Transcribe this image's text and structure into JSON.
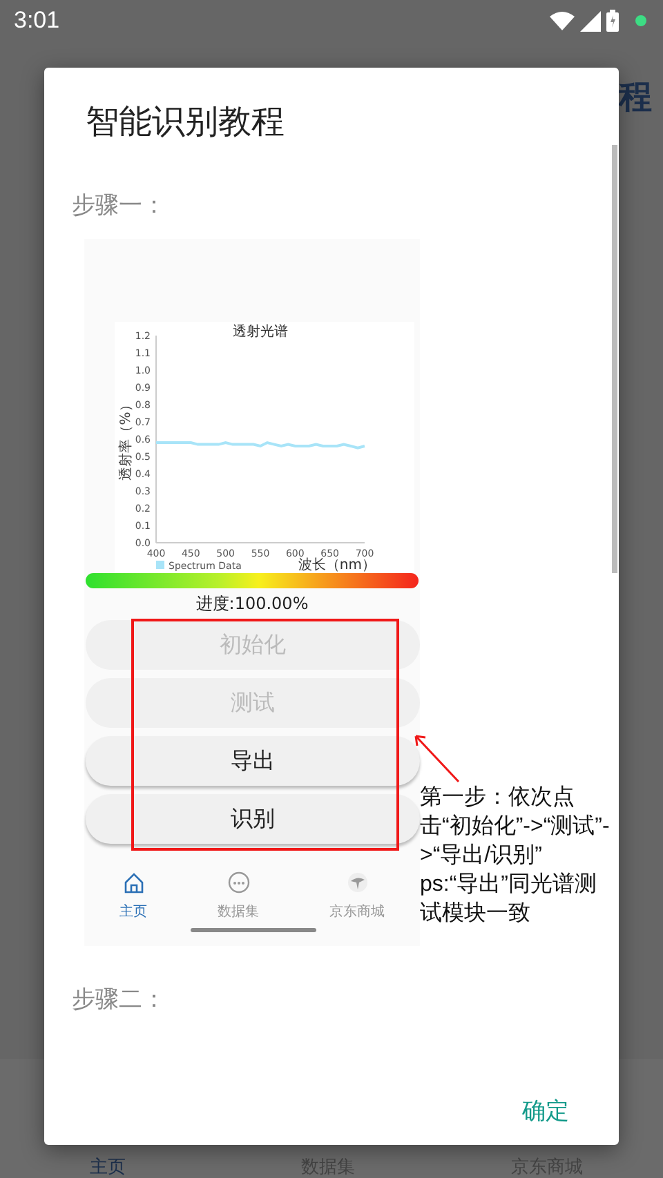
{
  "status_bar": {
    "time": "3:01"
  },
  "background": {
    "title_fragment": "程",
    "nav": [
      {
        "label": "主页",
        "selected": true
      },
      {
        "label": "数据集",
        "selected": false
      },
      {
        "label": "京东商城",
        "selected": false
      }
    ]
  },
  "dialog": {
    "title": "智能识别教程",
    "step_one": "步骤一：",
    "screenshot": {
      "chart_data": {
        "type": "line",
        "title": "透射光谱",
        "xlabel": "波长（nm）",
        "ylabel": "透射率（%）",
        "xlim": [
          400,
          700
        ],
        "ylim": [
          0,
          1.2
        ],
        "xticks": [
          400,
          450,
          500,
          550,
          600,
          650,
          700
        ],
        "yticks": [
          {
            "value": 0,
            "label": "0.0"
          },
          0.1,
          0.2,
          0.3,
          0.4,
          0.5,
          0.6,
          0.7,
          0.8,
          0.9,
          {
            "value": 1,
            "label": "1.0"
          },
          1.1,
          1.2
        ],
        "x": [
          400,
          410,
          420,
          430,
          440,
          450,
          460,
          470,
          480,
          490,
          500,
          510,
          520,
          530,
          540,
          550,
          560,
          570,
          580,
          590,
          600,
          610,
          620,
          630,
          640,
          650,
          660,
          670,
          680,
          690,
          700
        ],
        "series": [
          {
            "name": "Spectrum Data",
            "color": "#a8e4f8",
            "values": [
              0.58,
              0.58,
              0.58,
              0.58,
              0.58,
              0.58,
              0.57,
              0.57,
              0.57,
              0.57,
              0.58,
              0.57,
              0.57,
              0.57,
              0.57,
              0.56,
              0.58,
              0.57,
              0.56,
              0.57,
              0.56,
              0.56,
              0.56,
              0.57,
              0.56,
              0.56,
              0.56,
              0.57,
              0.56,
              0.55,
              0.56
            ]
          }
        ]
      },
      "progress": {
        "level": 1,
        "label": "进度:100.00%"
      },
      "buttons": [
        {
          "label": "初始化",
          "disabled": true
        },
        {
          "label": "测试",
          "disabled": true
        },
        {
          "label": "导出",
          "disabled": false
        },
        {
          "label": "识别",
          "disabled": false
        }
      ],
      "tabs": [
        {
          "label": "主页",
          "selected": true,
          "kind": "home"
        },
        {
          "label": "数据集",
          "selected": false,
          "kind": "chat"
        },
        {
          "label": "京东商城",
          "selected": false,
          "kind": "bird"
        }
      ]
    },
    "annotation": "第一步：依次点击“初始化”->“测试”->“导出/识别”\nps:“导出”同光谱测试模块一致",
    "step_two": "步骤二：",
    "confirm": "确定"
  }
}
